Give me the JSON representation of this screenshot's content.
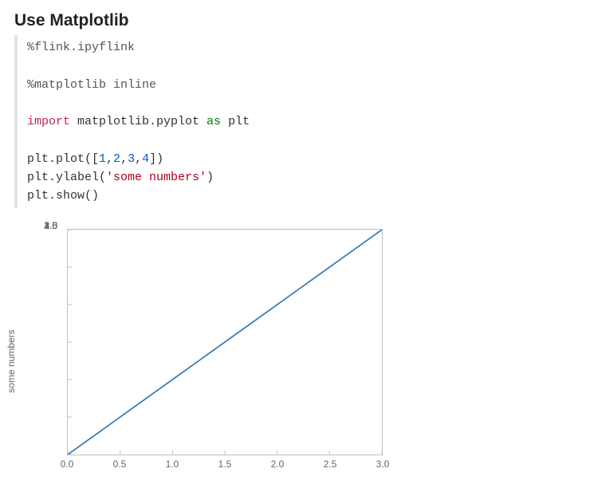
{
  "heading": "Use Matplotlib",
  "code": {
    "line1": "%flink.ipyflink",
    "line2": "%matplotlib inline",
    "kw_import": "import",
    "mod": " matplotlib.pyplot ",
    "kw_as": "as",
    "alias": " plt",
    "l4a": "plt.plot([",
    "n1": "1",
    "c1": ",",
    "n2": "2",
    "c2": ",",
    "n3": "3",
    "c3": ",",
    "n4": "4",
    "l4b": "])",
    "l5a": "plt.ylabel(",
    "str": "'some numbers'",
    "l5b": ")",
    "l6": "plt.show()"
  },
  "chart_data": {
    "type": "line",
    "x": [
      0,
      1,
      2,
      3
    ],
    "values": [
      1,
      2,
      3,
      4
    ],
    "xlabel": "",
    "ylabel": "some numbers",
    "xlim": [
      0.0,
      3.0
    ],
    "ylim": [
      1.0,
      4.0
    ],
    "x_ticks": [
      "0.0",
      "0.5",
      "1.0",
      "1.5",
      "2.0",
      "2.5",
      "3.0"
    ],
    "y_ticks": [
      "1.0",
      "1.5",
      "2.0",
      "2.5",
      "3.0",
      "3.5",
      "4.0"
    ],
    "line_color": "#3b7fb8"
  }
}
